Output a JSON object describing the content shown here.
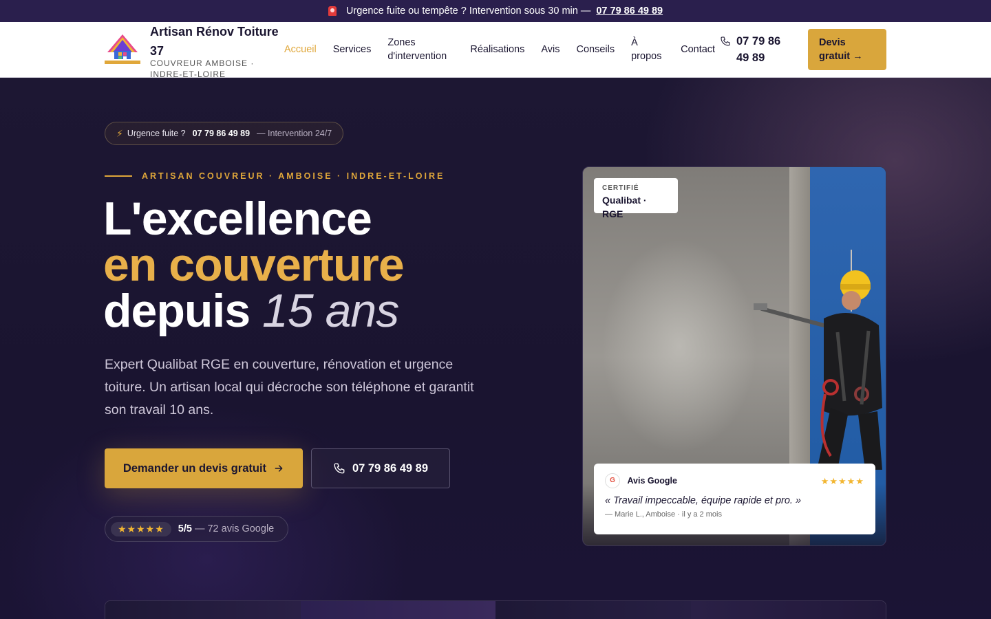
{
  "topbar": {
    "icon": "alarm-icon",
    "message": "Urgence fuite ou tempête ? Intervention sous 30 min —",
    "phone": "07 79 86 49 89"
  },
  "header": {
    "brand_title": "Artisan Rénov Toiture 37",
    "brand_subtitle": "COUVREUR AMBOISE · INDRE-ET-LOIRE",
    "nav": [
      "Accueil",
      "Services",
      "Zones d'intervention",
      "Réalisations",
      "Avis",
      "Conseils",
      "À propos",
      "Contact"
    ],
    "active_nav": "Accueil",
    "phone": "07 79 86 49 89",
    "cta": "Devis gratuit →"
  },
  "hero": {
    "pill": {
      "label": "Urgence fuite ?",
      "phone": "07 79 86 49 89",
      "note": "— Intervention 24/7"
    },
    "eyebrow": "ARTISAN COUVREUR · AMBOISE · INDRE-ET-LOIRE",
    "headline": {
      "line1": "L'excellence",
      "line2": "en couverture",
      "line3_bold": "depuis",
      "line3_italic": "15 ans"
    },
    "lead": "Expert Qualibat RGE en couverture, rénovation et urgence toiture. Un artisan local qui décroche son téléphone et garantit son travail 10 ans.",
    "cta_primary": "Demander un devis gratuit",
    "cta_phone": "07 79 86 49 89",
    "rating": {
      "stars": "★★★★★",
      "score": "5/5",
      "count": "— 72 avis Google"
    }
  },
  "card": {
    "badge_small": "CERTIFIÉ",
    "badge_big": "Qualibat · RGE",
    "review": {
      "source": "Avis Google",
      "g_letter": "G",
      "stars": "★★★★★",
      "quote": "« Travail impeccable, équipe rapide et pro. »",
      "author": "— Marie L., Amboise · il y a 2 mois"
    }
  },
  "colors": {
    "accent": "#d9a63c",
    "dark": "#1b1530",
    "topbar": "#2a1f4d"
  }
}
